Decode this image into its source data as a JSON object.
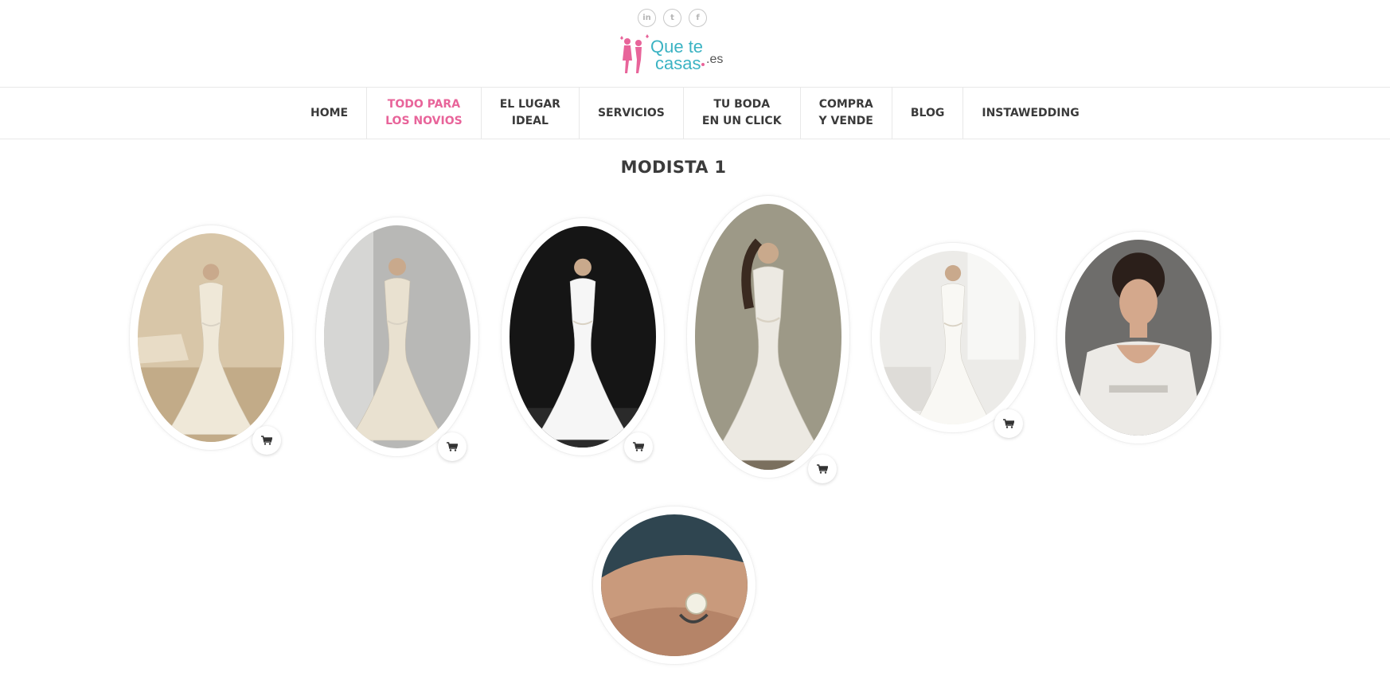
{
  "social": [
    {
      "name": "linkedin-icon",
      "glyph": "in"
    },
    {
      "name": "twitter-icon",
      "glyph": "t"
    },
    {
      "name": "facebook-icon",
      "glyph": "f"
    }
  ],
  "logo": {
    "line1": "Que te",
    "line2": "casas",
    "suffix": ".es"
  },
  "nav": [
    {
      "label": "HOME",
      "active": false
    },
    {
      "label": "TODO PARA\nLOS NOVIOS",
      "active": true
    },
    {
      "label": "EL LUGAR\nIDEAL",
      "active": false
    },
    {
      "label": "SERVICIOS",
      "active": false
    },
    {
      "label": "TU BODA\nEN UN CLICK",
      "active": false
    },
    {
      "label": "COMPRA\nY VENDE",
      "active": false
    },
    {
      "label": "BLOG",
      "active": false
    },
    {
      "label": "INSTAWEDDING",
      "active": false
    }
  ],
  "page": {
    "title": "MODISTA 1"
  },
  "gallery": [
    {
      "name": "gallery-item-dress-1",
      "scene": "beige",
      "cart": true
    },
    {
      "name": "gallery-item-dress-2",
      "scene": "grey",
      "cart": true
    },
    {
      "name": "gallery-item-dress-3",
      "scene": "dark",
      "cart": true
    },
    {
      "name": "gallery-item-dress-4",
      "scene": "stone",
      "cart": true
    },
    {
      "name": "gallery-item-dress-5",
      "scene": "white",
      "cart": true
    },
    {
      "name": "gallery-item-dress-6",
      "scene": "portrait",
      "cart": false
    },
    {
      "name": "gallery-item-ring",
      "scene": "ring",
      "cart": false
    }
  ],
  "colors": {
    "accent": "#e8649a",
    "logo_teal": "#3bb3c3",
    "logo_pink": "#e8649a",
    "nav_text": "#3a3a3a"
  }
}
